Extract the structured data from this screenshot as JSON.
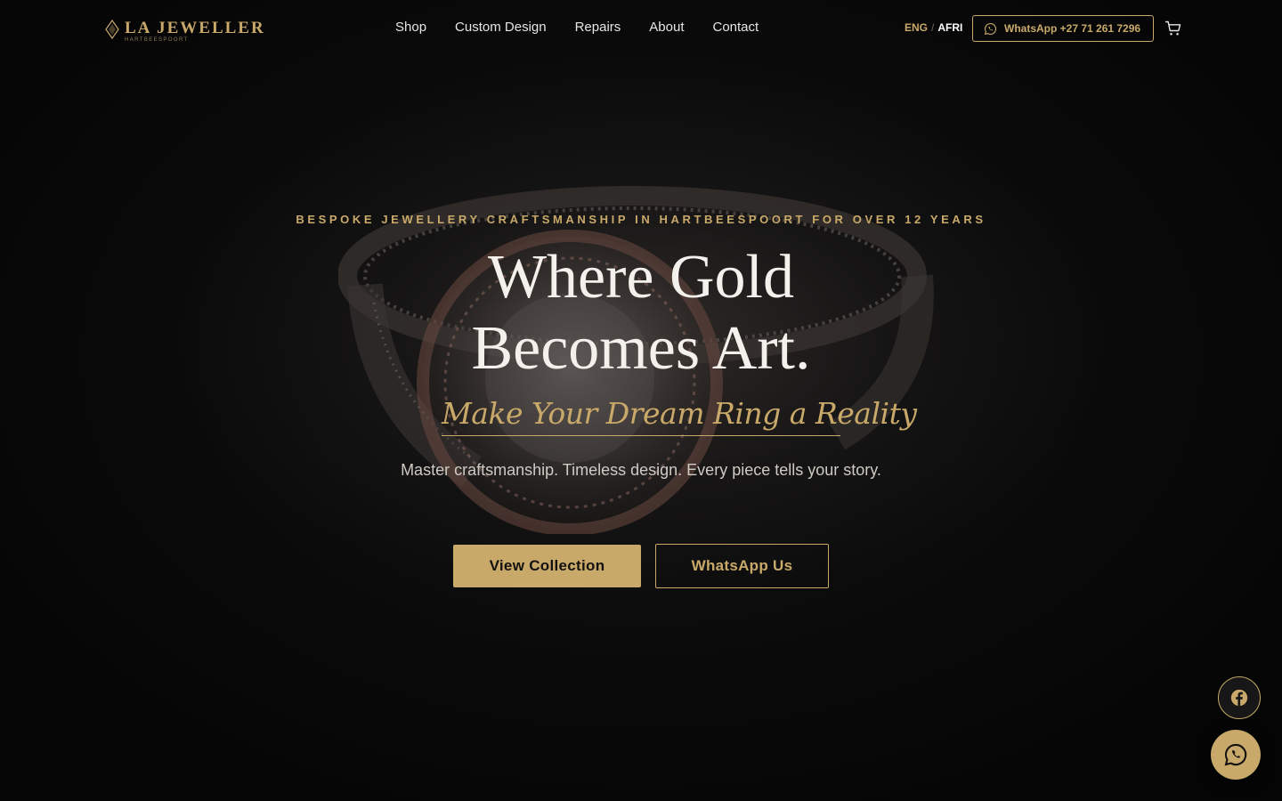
{
  "brand": {
    "name": "LA JEWELLER",
    "location": "HARTBEESPOORT"
  },
  "nav": {
    "items": [
      "Shop",
      "Custom Design",
      "Repairs",
      "About",
      "Contact"
    ]
  },
  "language": {
    "eng": "ENG",
    "separator": "/",
    "afri": "AFRI"
  },
  "whatsapp_pill": {
    "label": "WhatsApp +27 71 261 7296"
  },
  "hero": {
    "tagline": "BESPOKE JEWELLERY CRAFTSMANSHIP IN HARTBEESPOORT FOR OVER 12 YEARS",
    "headline_line1": "Where Gold",
    "headline_line2": "Becomes Art.",
    "script": "Make Your Dream Ring a Reality",
    "lead": "Master craftsmanship. Timeless design. Every piece tells your story.",
    "primary_cta": "View Collection",
    "secondary_cta": "WhatsApp Us"
  },
  "icons": {
    "logo": "diamond-icon",
    "whatsapp": "whatsapp-icon",
    "cart": "cart-icon",
    "facebook": "facebook-icon"
  },
  "colors": {
    "gold": "#c9a96a",
    "background": "#050505",
    "text": "#f4f1ec"
  }
}
